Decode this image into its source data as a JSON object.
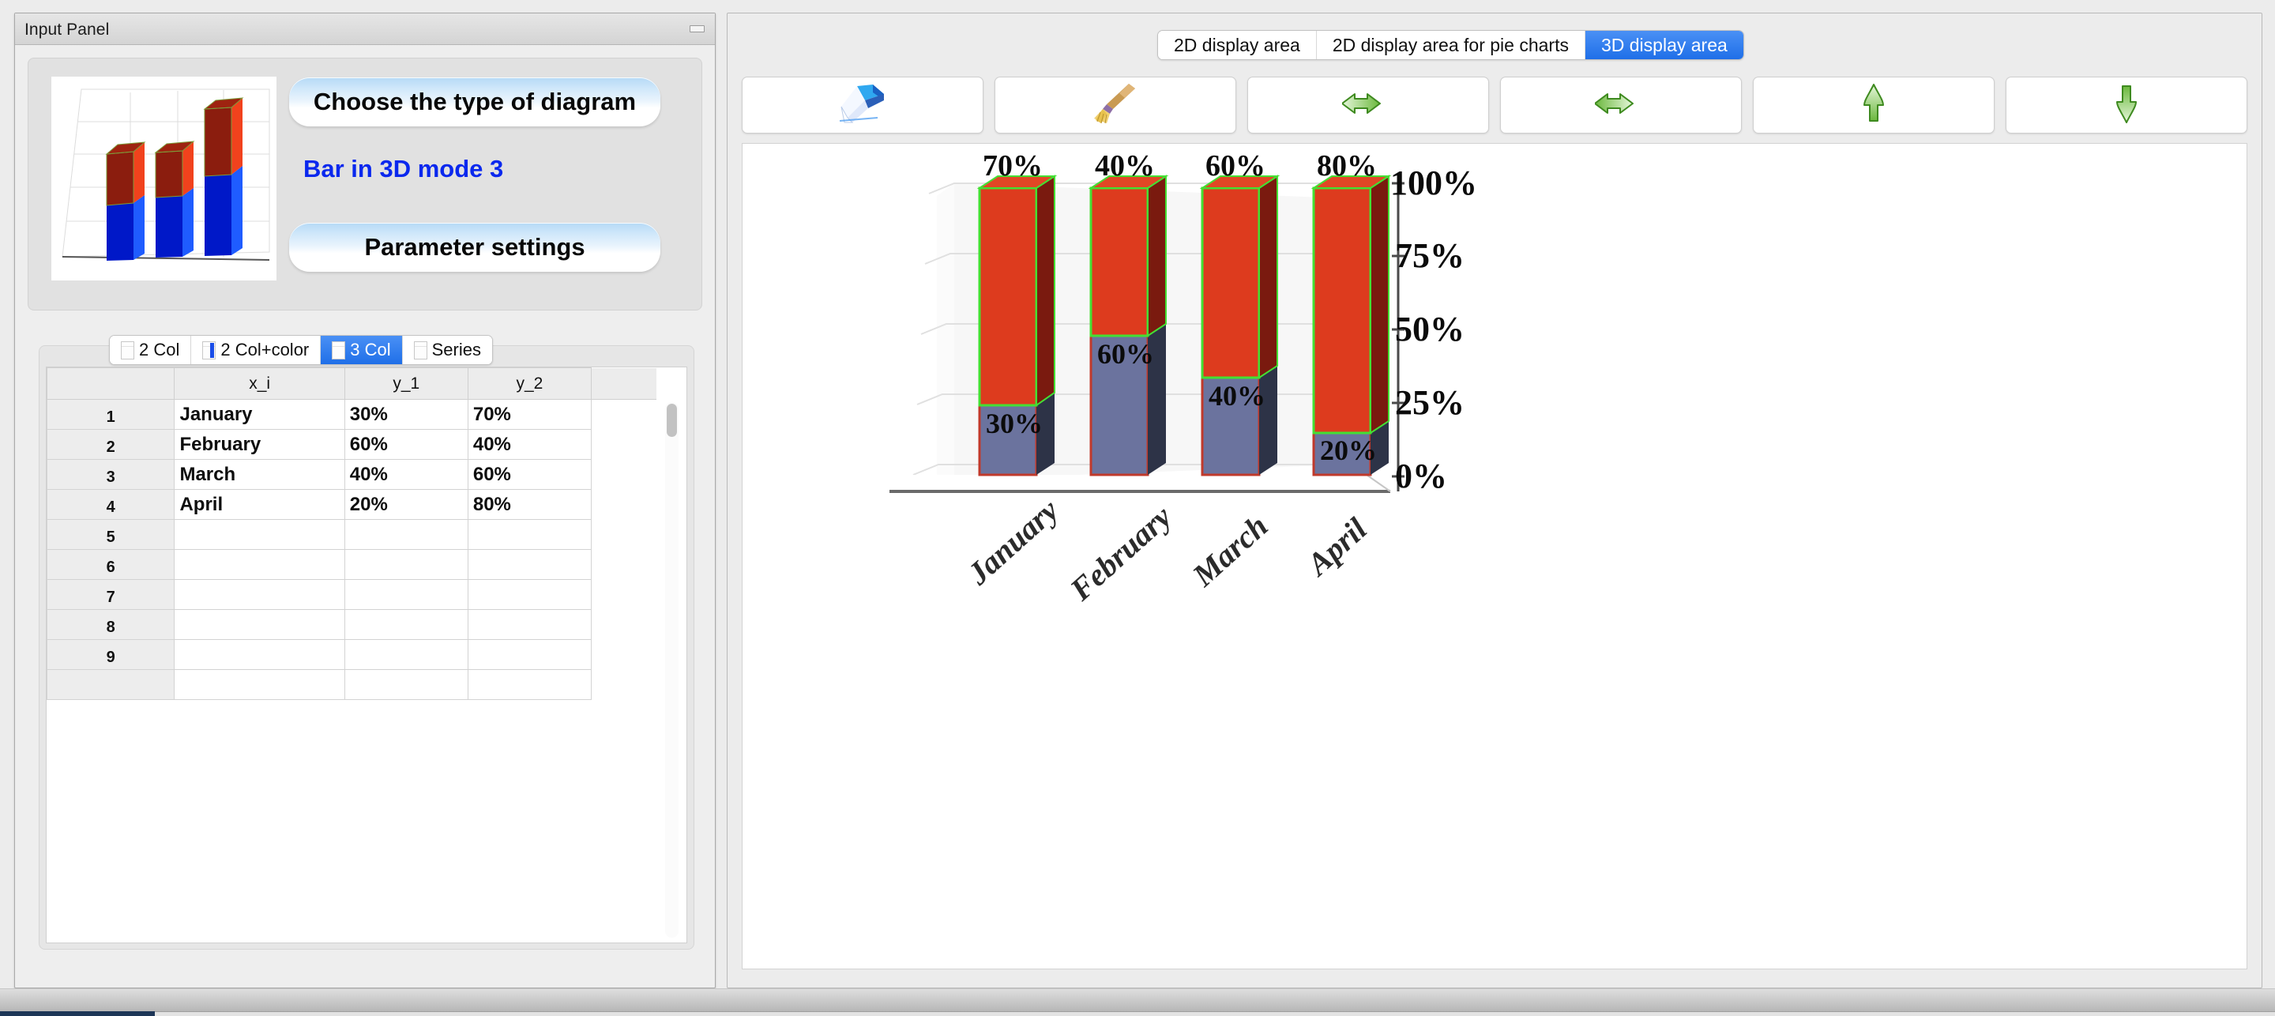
{
  "input_panel": {
    "title": "Input Panel",
    "minimize_icon": "minimize-icon",
    "choose_type_label": "Choose the type of diagram",
    "mode_label": "Bar in 3D mode 3",
    "parameter_settings_label": "Parameter settings",
    "preview_icon": "bar-3d-preview-thumbnail",
    "tabs": [
      {
        "label": "2 Col",
        "icon": "sheet-2col-icon",
        "selected": false
      },
      {
        "label": "2 Col+color",
        "icon": "sheet-2col-color-icon",
        "selected": false
      },
      {
        "label": "3 Col",
        "icon": "sheet-3col-icon",
        "selected": true
      },
      {
        "label": "Series",
        "icon": "sheet-series-icon",
        "selected": false
      }
    ],
    "grid": {
      "headers": [
        "",
        "x_i",
        "y_1",
        "y_2"
      ],
      "rows": [
        {
          "index": "1",
          "x_i": "January",
          "y_1": "30%",
          "y_2": "70%"
        },
        {
          "index": "2",
          "x_i": "February",
          "y_1": "60%",
          "y_2": "40%"
        },
        {
          "index": "3",
          "x_i": "March",
          "y_1": "40%",
          "y_2": "60%"
        },
        {
          "index": "4",
          "x_i": "April",
          "y_1": "20%",
          "y_2": "80%"
        },
        {
          "index": "5",
          "x_i": "",
          "y_1": "",
          "y_2": ""
        },
        {
          "index": "6",
          "x_i": "",
          "y_1": "",
          "y_2": ""
        },
        {
          "index": "7",
          "x_i": "",
          "y_1": "",
          "y_2": ""
        },
        {
          "index": "8",
          "x_i": "",
          "y_1": "",
          "y_2": ""
        },
        {
          "index": "9",
          "x_i": "",
          "y_1": "",
          "y_2": ""
        },
        {
          "index": "",
          "x_i": "",
          "y_1": "",
          "y_2": ""
        }
      ]
    }
  },
  "display_panel": {
    "tabs": [
      {
        "label": "2D display area",
        "selected": false
      },
      {
        "label": "2D display area for pie charts",
        "selected": false
      },
      {
        "label": "3D display area",
        "selected": true
      }
    ],
    "toolbar": [
      {
        "icon": "eraser-icon"
      },
      {
        "icon": "broom-icon"
      },
      {
        "icon": "arrow-left-icon"
      },
      {
        "icon": "arrow-right-icon"
      },
      {
        "icon": "arrow-up-icon"
      },
      {
        "icon": "arrow-down-icon"
      }
    ]
  },
  "colors": {
    "accent_blue": "#1f6fe8",
    "mode_text_blue": "#0a28ee",
    "bar_segment_lower": "#6b739e",
    "bar_segment_upper": "#dd3b1e",
    "bar_outline_lower": "#c0392b",
    "bar_outline_upper": "#44e033",
    "bar_side_lower": "#2d3347",
    "bar_side_upper": "#7a1a0f",
    "panel_bg": "#ececec"
  },
  "chart_data": {
    "type": "bar",
    "subtype": "stacked-3d",
    "title": "",
    "xlabel": "",
    "ylabel": "",
    "categories": [
      "January",
      "February",
      "March",
      "April"
    ],
    "series": [
      {
        "name": "y_1",
        "values": [
          30,
          60,
          40,
          20
        ],
        "color": "#6b739e"
      },
      {
        "name": "y_2",
        "values": [
          70,
          40,
          60,
          80
        ],
        "color": "#dd3b1e"
      }
    ],
    "data_labels": {
      "lower": [
        "30%",
        "60%",
        "40%",
        "20%"
      ],
      "upper": [
        "70%",
        "40%",
        "60%",
        "80%"
      ]
    },
    "y_ticks": [
      "0%",
      "25%",
      "50%",
      "75%",
      "100%"
    ],
    "y_tick_values": [
      0,
      25,
      50,
      75,
      100
    ],
    "ylim": [
      0,
      100
    ],
    "grid": true,
    "legend": false,
    "x_tick_rotation_deg": -45
  }
}
